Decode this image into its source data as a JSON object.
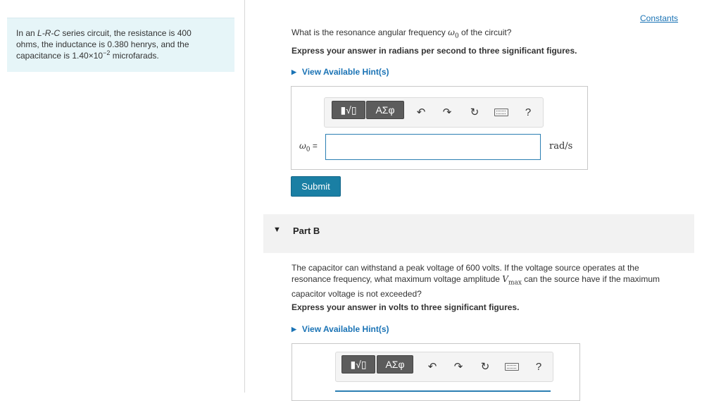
{
  "problem": {
    "line1_pre": "In an ",
    "line1_em": "L-R-C",
    "line1_post": " series circuit, the resistance is 400",
    "line2": "ohms, the inductance is 0.380 henrys, and the",
    "line3_pre": "capacitance is 1.40×10",
    "line3_exp": "−2",
    "line3_post": " microfarads."
  },
  "constants_link": "Constants",
  "part_a": {
    "question_pre": "What is the resonance angular frequency ",
    "symbol": "ω",
    "subscript": "0",
    "question_post": " of the circuit?",
    "instruction": "Express your answer in radians per second to three significant figures.",
    "hint": "View Available Hint(s)",
    "answer_label": "ω",
    "answer_label_sub": "0",
    "answer_label_eq": " =",
    "answer_value": "",
    "units": "rad/s",
    "submit_label": "Submit"
  },
  "toolbar": {
    "templates_label": "▮√▯",
    "symbols_label": "ΑΣφ",
    "help_label": "?",
    "undo_icon": "undo-icon",
    "redo_icon": "redo-icon",
    "reset_icon": "reset-icon",
    "keyboard_icon": "keyboard-icon"
  },
  "part_b": {
    "title": "Part B",
    "para_line1": "The capacitor can withstand a peak voltage of 600 volts. If the voltage source operates at the",
    "para_line2_pre": "resonance frequency, what maximum voltage amplitude ",
    "vmax_symbol": "V",
    "vmax_sub": "max",
    "para_line2_post": " can the source have if the maximum",
    "para_line3": "capacitor voltage is not exceeded?",
    "instruction": "Express your answer in volts to three significant figures.",
    "hint": "View Available Hint(s)"
  },
  "colors": {
    "link": "#1a73b5",
    "submit": "#1a7fa4",
    "problem_bg": "#e6f5f8",
    "input_border": "#2b7fb3"
  }
}
